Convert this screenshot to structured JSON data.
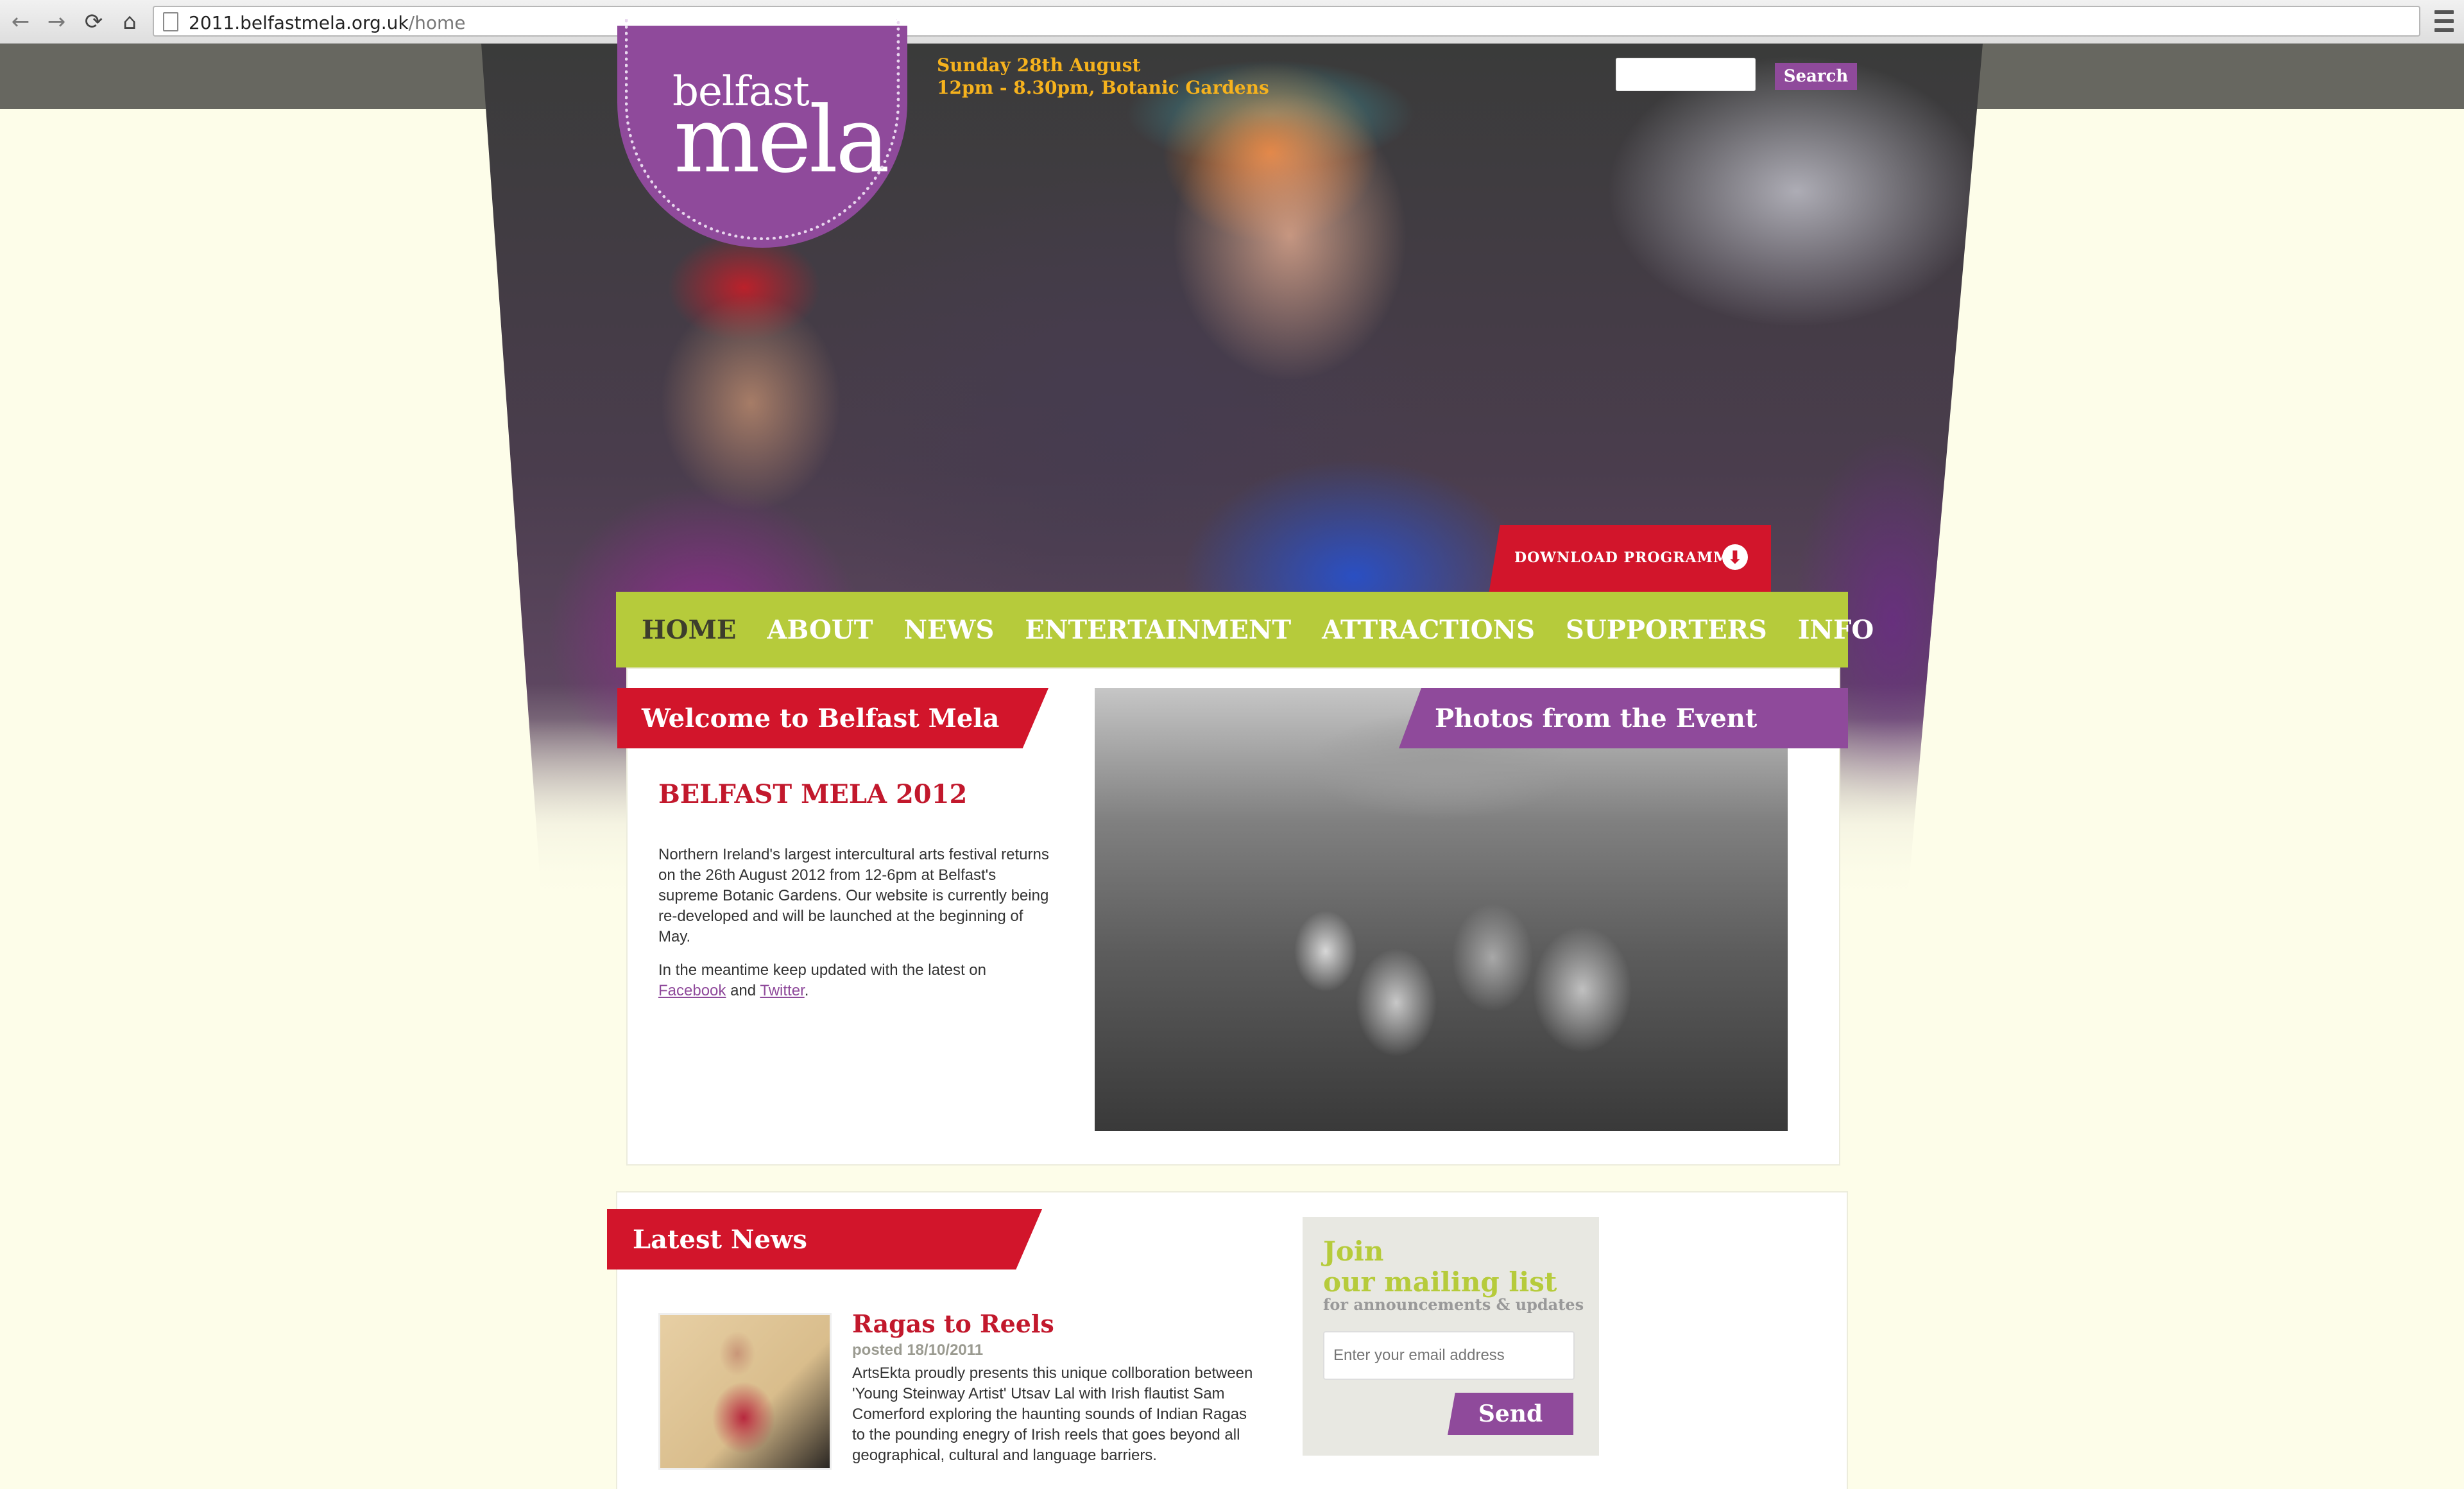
{
  "browser": {
    "url_host": "2011.belfastmela.org.uk",
    "url_path": "/home",
    "back_icon": "←",
    "forward_icon": "→",
    "reload_icon": "⟳",
    "home_icon": "⌂"
  },
  "header": {
    "logo_small": "belfast",
    "logo_big": "mela",
    "date_line1": "Sunday 28th August",
    "date_line2": "12pm - 8.30pm, Botanic Gardens",
    "search_button": "Search",
    "download_label": "DOWNLOAD PROGRAMME",
    "download_icon": "⬇"
  },
  "nav": {
    "items": [
      "HOME",
      "ABOUT",
      "NEWS",
      "ENTERTAINMENT",
      "ATTRACTIONS",
      "SUPPORTERS",
      "INFO"
    ],
    "active": "HOME"
  },
  "welcome": {
    "banner": "Welcome to Belfast Mela",
    "heading": "BELFAST MELA 2012",
    "paragraph1": "Northern Ireland's largest intercultural arts festival returns on the 26th August 2012 from 12-6pm at Belfast's supreme Botanic Gardens. Our website is currently being re-developed and will be launched at the beginning of May.",
    "paragraph2_prefix": "In the meantime keep updated with the latest on ",
    "facebook_link": "Facebook",
    "and_text": " and ",
    "twitter_link": "Twitter",
    "period": "."
  },
  "photos": {
    "banner": "Photos from the Event"
  },
  "news": {
    "banner": "Latest News",
    "item": {
      "title": "Ragas to Reels",
      "date": "posted 18/10/2011",
      "body": "ArtsEkta proudly presents this unique collboration between 'Young Steinway Artist' Utsav Lal with Irish flautist Sam Comerford exploring the haunting sounds of Indian Ragas to the pounding enegry of Irish reels that goes beyond all geographical, cultural and language barriers."
    }
  },
  "mailing": {
    "line1": "Join",
    "line2": "our mailing list",
    "sub": "for announcements & updates",
    "placeholder": "Enter your email address",
    "send": "Send"
  },
  "colors": {
    "purple": "#8f4a9b",
    "red": "#d2152b",
    "green": "#b6cb3b",
    "gold": "#f6b21d"
  }
}
